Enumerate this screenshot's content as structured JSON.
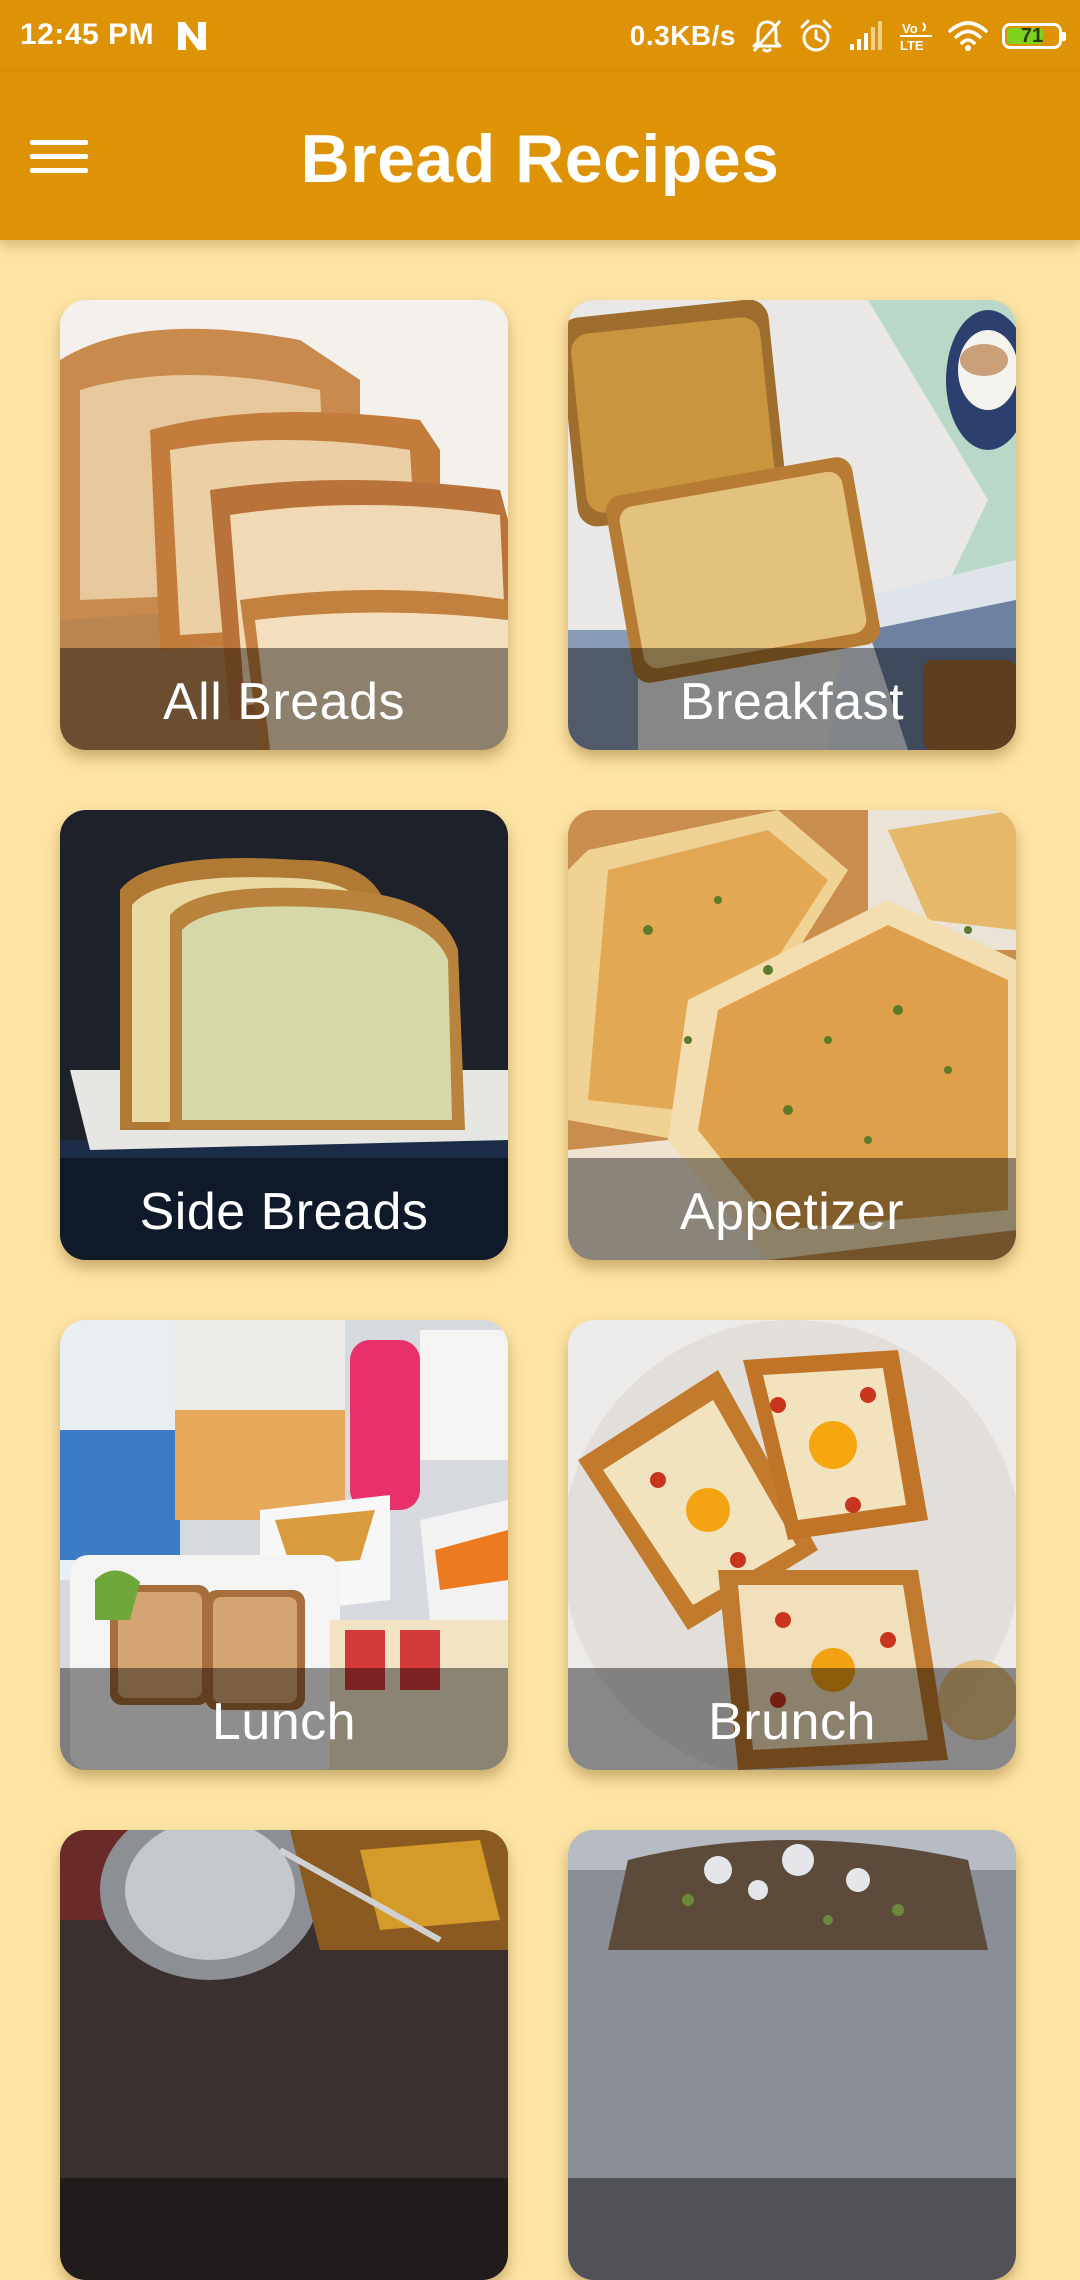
{
  "status_bar": {
    "time": "12:45 PM",
    "network_speed": "0.3KB/s",
    "battery_level": "71",
    "battery_fraction": 0.71,
    "icons": [
      "n-notification-icon",
      "mute-icon",
      "alarm-icon",
      "signal-icon",
      "volte-icon",
      "wifi-icon",
      "battery-icon"
    ]
  },
  "app_bar": {
    "title": "Bread Recipes",
    "menu_icon": "hamburger-menu-icon"
  },
  "colors": {
    "primary": "#de9206",
    "background": "#fde4a4",
    "battery_green": "#7ed321"
  },
  "categories": [
    {
      "label": "All Breads"
    },
    {
      "label": "Breakfast"
    },
    {
      "label": "Side Breads"
    },
    {
      "label": "Appetizer"
    },
    {
      "label": "Lunch"
    },
    {
      "label": "Brunch"
    },
    {
      "label": ""
    },
    {
      "label": ""
    }
  ]
}
